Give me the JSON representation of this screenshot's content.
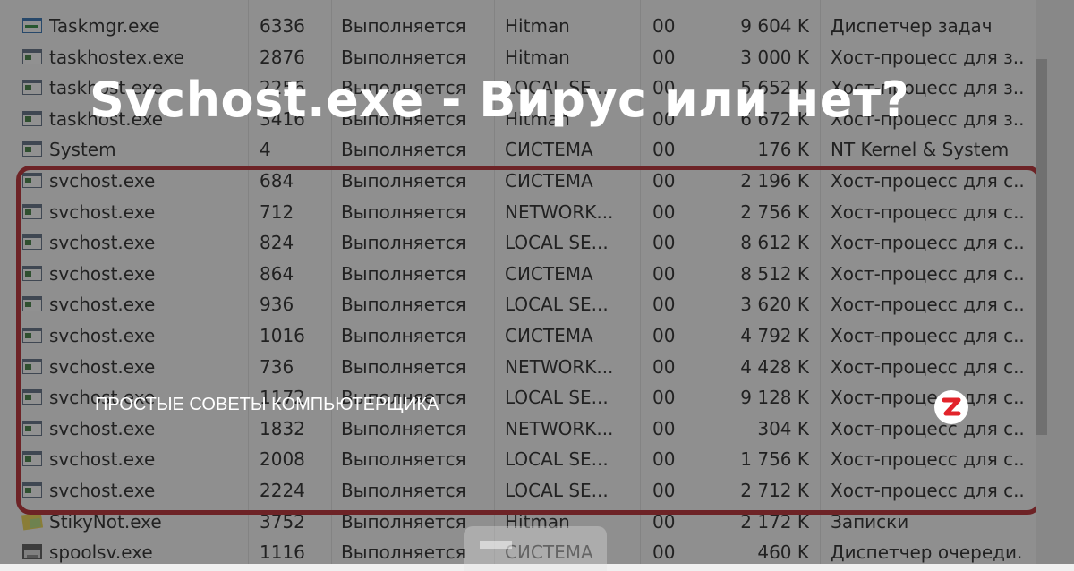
{
  "headline": "Svchost.exe - Вирус или нет?",
  "channel_name": "ПРОСТЫЕ СОВЕТЫ КОМПЬЮТЕРЩИКА",
  "logo_icon": "zen-logo-icon",
  "colors": {
    "highlight_border": "#b72328",
    "overlay": "#232323",
    "logo_mark": "#e2242b"
  },
  "processes": [
    {
      "icon": "taskmgr-icon",
      "name": "Taskmgr.exe",
      "pid": "6336",
      "status": "Выполняется",
      "user": "Hitman",
      "cpu": "00",
      "memory": "9 604 K",
      "description": "Диспетчер задач"
    },
    {
      "icon": "app-window-icon",
      "name": "taskhostex.exe",
      "pid": "2876",
      "status": "Выполняется",
      "user": "Hitman",
      "cpu": "00",
      "memory": "3 000 K",
      "description": "Хост-процесс для з..."
    },
    {
      "icon": "app-window-icon",
      "name": "taskhost.exe",
      "pid": "2256",
      "status": "Выполняется",
      "user": "LOCAL SE...",
      "cpu": "00",
      "memory": "5 652 K",
      "description": "Хост-процесс для з..."
    },
    {
      "icon": "app-window-icon",
      "name": "taskhost.exe",
      "pid": "3416",
      "status": "Выполняется",
      "user": "Hitman",
      "cpu": "00",
      "memory": "6 672 K",
      "description": "Хост-процесс для з..."
    },
    {
      "icon": "app-window-icon",
      "name": "System",
      "pid": "4",
      "status": "Выполняется",
      "user": "СИСТЕМА",
      "cpu": "00",
      "memory": "176 K",
      "description": "NT Kernel & System"
    },
    {
      "icon": "app-window-icon",
      "name": "svchost.exe",
      "pid": "684",
      "status": "Выполняется",
      "user": "СИСТЕМА",
      "cpu": "00",
      "memory": "2 196 K",
      "description": "Хост-процесс для с..."
    },
    {
      "icon": "app-window-icon",
      "name": "svchost.exe",
      "pid": "712",
      "status": "Выполняется",
      "user": "NETWORK...",
      "cpu": "00",
      "memory": "2 756 K",
      "description": "Хост-процесс для с..."
    },
    {
      "icon": "app-window-icon",
      "name": "svchost.exe",
      "pid": "824",
      "status": "Выполняется",
      "user": "LOCAL SE...",
      "cpu": "00",
      "memory": "8 612 K",
      "description": "Хост-процесс для с..."
    },
    {
      "icon": "app-window-icon",
      "name": "svchost.exe",
      "pid": "864",
      "status": "Выполняется",
      "user": "СИСТЕМА",
      "cpu": "00",
      "memory": "8 512 K",
      "description": "Хост-процесс для с..."
    },
    {
      "icon": "app-window-icon",
      "name": "svchost.exe",
      "pid": "936",
      "status": "Выполняется",
      "user": "LOCAL SE...",
      "cpu": "00",
      "memory": "3 620 K",
      "description": "Хост-процесс для с..."
    },
    {
      "icon": "app-window-icon",
      "name": "svchost.exe",
      "pid": "1016",
      "status": "Выполняется",
      "user": "СИСТЕМА",
      "cpu": "00",
      "memory": "4 792 K",
      "description": "Хост-процесс для с..."
    },
    {
      "icon": "app-window-icon",
      "name": "svchost.exe",
      "pid": "736",
      "status": "Выполняется",
      "user": "NETWORK...",
      "cpu": "00",
      "memory": "4 428 K",
      "description": "Хост-процесс для с..."
    },
    {
      "icon": "app-window-icon",
      "name": "svchost.exe",
      "pid": "1172",
      "status": "Выполняется",
      "user": "LOCAL SE...",
      "cpu": "00",
      "memory": "9 128 K",
      "description": "Хост-процесс для с..."
    },
    {
      "icon": "app-window-icon",
      "name": "svchost.exe",
      "pid": "1832",
      "status": "Выполняется",
      "user": "NETWORK...",
      "cpu": "00",
      "memory": "304 K",
      "description": "Хост-процесс для с..."
    },
    {
      "icon": "app-window-icon",
      "name": "svchost.exe",
      "pid": "2008",
      "status": "Выполняется",
      "user": "LOCAL SE...",
      "cpu": "00",
      "memory": "1 756 K",
      "description": "Хост-процесс для с..."
    },
    {
      "icon": "app-window-icon",
      "name": "svchost.exe",
      "pid": "2224",
      "status": "Выполняется",
      "user": "LOCAL SE...",
      "cpu": "00",
      "memory": "2 712 K",
      "description": "Хост-процесс для с..."
    },
    {
      "icon": "sticky-notes-icon",
      "name": "StikyNot.exe",
      "pid": "3752",
      "status": "Выполняется",
      "user": "Hitman",
      "cpu": "00",
      "memory": "2 172 K",
      "description": "Записки"
    },
    {
      "icon": "printer-icon",
      "name": "spoolsv.exe",
      "pid": "1116",
      "status": "Выполняется",
      "user": "СИСТЕМА",
      "cpu": "00",
      "memory": "460 K",
      "description": "Диспетчер очереди..."
    }
  ]
}
